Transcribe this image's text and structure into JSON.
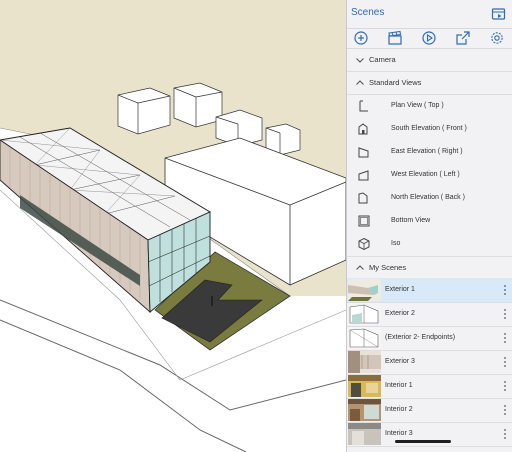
{
  "panel": {
    "title": "Scenes",
    "camera_label": "Camera",
    "standard_views_label": "Standard Views",
    "standard_views": [
      {
        "label": "Plan View ( Top )",
        "icon": "plan-view-icon"
      },
      {
        "label": "South Elevation ( Front )",
        "icon": "south-elevation-icon"
      },
      {
        "label": "East Elevation ( Right )",
        "icon": "east-elevation-icon"
      },
      {
        "label": "West Elevation ( Left )",
        "icon": "west-elevation-icon"
      },
      {
        "label": "North Elevation ( Back )",
        "icon": "north-elevation-icon"
      },
      {
        "label": "Bottom View",
        "icon": "bottom-view-icon"
      },
      {
        "label": "Iso",
        "icon": "iso-view-icon"
      }
    ],
    "my_scenes_label": "My Scenes",
    "my_scenes": [
      {
        "label": "Exterior 1",
        "selected": true
      },
      {
        "label": "Exterior 2",
        "selected": false
      },
      {
        "label": "(Exterior 2- Endpoints)",
        "selected": false
      },
      {
        "label": "Exterior 3",
        "selected": false
      },
      {
        "label": "Interior 1",
        "selected": false
      },
      {
        "label": "Interior 2",
        "selected": false
      },
      {
        "label": "Interior 3",
        "selected": false
      }
    ],
    "toolbar_icons": [
      "add-scene-icon",
      "scene-clapper-icon",
      "play-icon",
      "export-icon",
      "settings-icon"
    ]
  },
  "colors": {
    "accent": "#2f6bb3",
    "selected_row": "#d9e9f7",
    "panel_bg": "#f2f2f4",
    "ground": "#e8e3cf",
    "grass": "#7a7c3f"
  }
}
